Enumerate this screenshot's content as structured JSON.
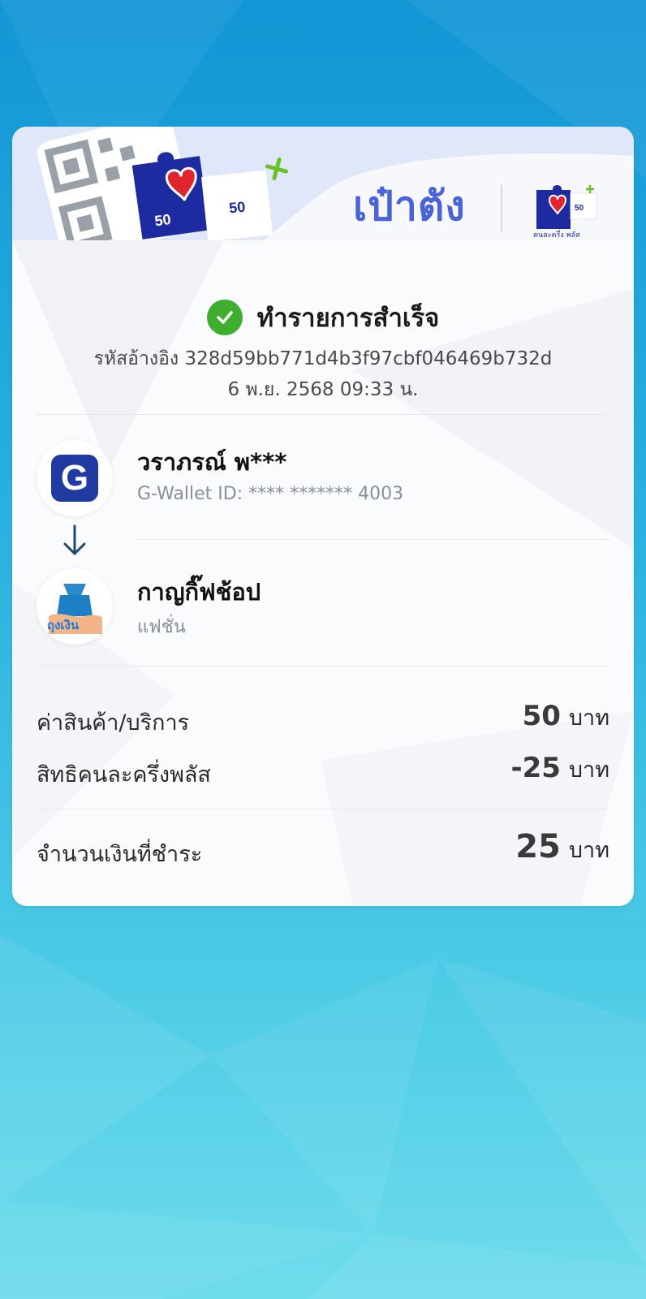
{
  "colors": {
    "accent": "#4a63d8",
    "success": "#3fae2f",
    "brand_dark": "#1f3aa0"
  },
  "header": {
    "brand_title": "เป๋าตัง",
    "logo_text": "คนละครึ่ง พลัส",
    "logo_badge_number": "50",
    "banner_piece_left": "50",
    "banner_piece_right": "50"
  },
  "status": {
    "text": "ทำรายการสำเร็จ",
    "icon": "check-circle-icon"
  },
  "reference": "รหัสอ้างอิง 328d59bb771d4b3f97cbf046469b732d",
  "datetime": "6 พ.ย. 2568 09:33 น.",
  "payer": {
    "name": "วราภรณ์ พ***",
    "sub": "G-Wallet ID: **** ******* 4003",
    "avatar_letter": "G"
  },
  "payee": {
    "name": "กาญกิ๊ฟช้อป",
    "sub": "แฟชั่น",
    "avatar_text": "ถุงเงิน"
  },
  "summary": {
    "rows": [
      {
        "label": "ค่าสินค้า/บริการ",
        "amount": "50",
        "unit": "บาท"
      },
      {
        "label": "สิทธิคนละครึ่งพลัส",
        "amount": "-25",
        "unit": "บาท"
      }
    ],
    "total": {
      "label": "จำนวนเงินที่ชำระ",
      "amount": "25",
      "unit": "บาท"
    }
  }
}
